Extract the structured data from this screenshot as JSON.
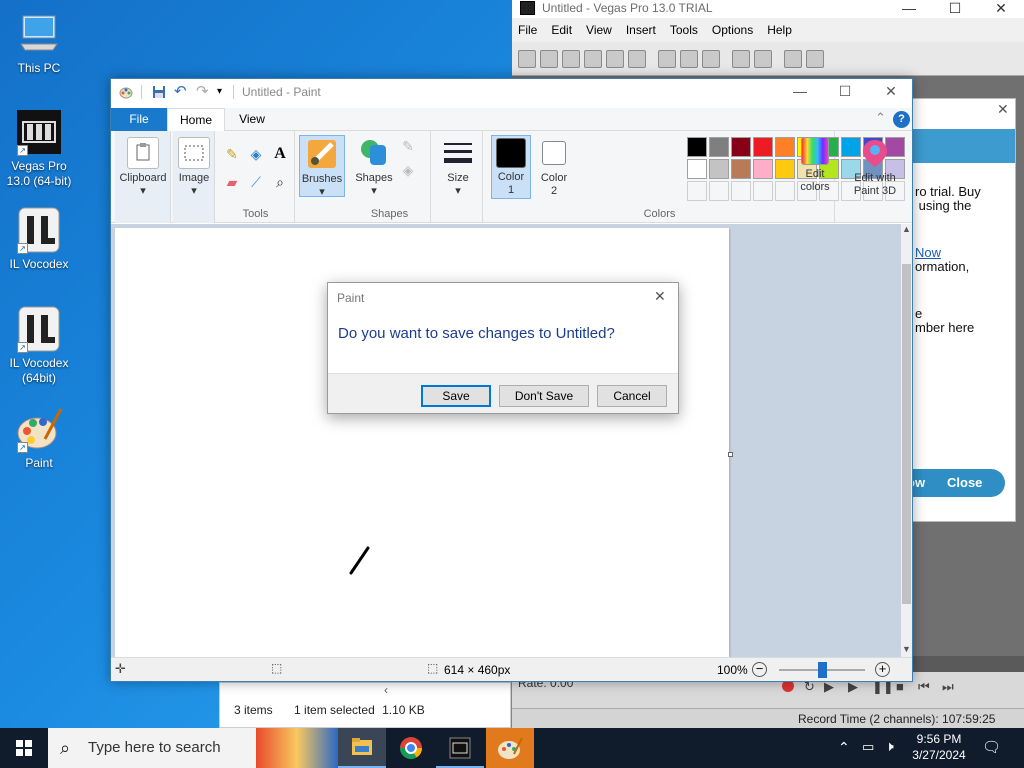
{
  "desktop": {
    "icons": [
      {
        "label": "This PC",
        "icon": "computer-icon"
      },
      {
        "label": "Vegas Pro\n13.0 (64-bit)",
        "icon": "film-icon"
      },
      {
        "label": "IL Vocodex",
        "icon": "il-vocodex-icon"
      },
      {
        "label": "IL Vocodex\n(64bit)",
        "icon": "il-vocodex-icon"
      },
      {
        "label": "Paint",
        "icon": "paint-palette-icon"
      }
    ]
  },
  "vegas": {
    "title": "Untitled - Vegas Pro 13.0 TRIAL",
    "menu": [
      "File",
      "Edit",
      "View",
      "Insert",
      "Tools",
      "Options",
      "Help"
    ],
    "trial_dialog": {
      "line1": "ro trial. Buy",
      "line2": " using the",
      "link": "Now",
      "line3": "ormation,",
      "line4": "e",
      "line5": "mber here",
      "buy_label": "ow",
      "close_label": "Close"
    },
    "rate_label": "Rate: 0.00",
    "record_time": "Record Time (2 channels): 107:59:25"
  },
  "explorer": {
    "items_count": "3 items",
    "selection": "1 item selected",
    "size": "1.10 KB"
  },
  "paint": {
    "title": "Untitled - Paint",
    "tabs": {
      "file": "File",
      "home": "Home",
      "view": "View"
    },
    "ribbon": {
      "clipboard": "Clipboard",
      "image": "Image",
      "tools": "Tools",
      "brushes": "Brushes",
      "shapes_btn": "Shapes",
      "shapes_group": "Shapes",
      "size": "Size",
      "color1": "Color\n1",
      "color2": "Color\n2",
      "colors_group": "Colors",
      "edit_colors": "Edit\ncolors",
      "edit_paint3d": "Edit with\nPaint 3D"
    },
    "palette_row1": [
      "#000000",
      "#7f7f7f",
      "#880015",
      "#ed1c24",
      "#ff7f27",
      "#fff200",
      "#22b14c",
      "#00a2e8",
      "#3f48cc",
      "#a349a4"
    ],
    "palette_row2": [
      "#ffffff",
      "#c3c3c3",
      "#b97a57",
      "#ffaec9",
      "#ffc90e",
      "#efe4b0",
      "#b5e61d",
      "#99d9ea",
      "#7092be",
      "#c8bfe7"
    ],
    "color1": "#000000",
    "color2": "#ffffff",
    "status": {
      "canvas_size": "614 × 460px",
      "zoom": "100%",
      "zoom_level": 0.5
    }
  },
  "dialog": {
    "title": "Paint",
    "message": "Do you want to save changes to Untitled?",
    "save": "Save",
    "dont_save": "Don't Save",
    "cancel": "Cancel"
  },
  "taskbar": {
    "search_placeholder": "Type here to search",
    "time": "9:56 PM",
    "date": "3/27/2024"
  }
}
